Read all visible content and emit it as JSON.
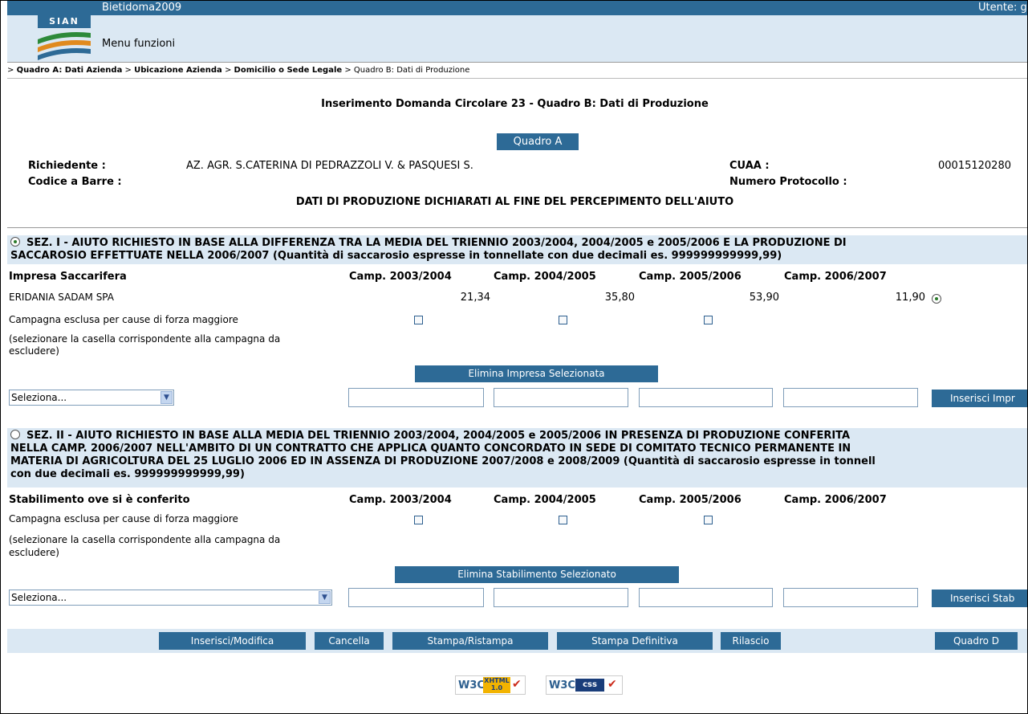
{
  "header": {
    "app_title": "Bietidoma2009",
    "user_label": "Utente: g",
    "menu": "Menu funzioni",
    "logo_text": "SIAN"
  },
  "breadcrumb": {
    "sep": ">",
    "items": [
      "Quadro A: Dati Azienda",
      "Ubicazione Azienda",
      "Domicilio o Sede Legale"
    ],
    "current": "Quadro B: Dati di Produzione"
  },
  "page_title": "Inserimento Domanda Circolare 23 - Quadro B: Dati di Produzione",
  "quadro_a_button": "Quadro A",
  "applicant": {
    "richiedente_label": "Richiedente :",
    "richiedente_value": "AZ. AGR. S.CATERINA DI PEDRAZZOLI V. & PASQUESI S.",
    "cuaa_label": "CUAA :",
    "cuaa_value": "00015120280",
    "barcode_label": "Codice a Barre :",
    "protocol_label": "Numero Protocollo :"
  },
  "subtitle": "DATI DI PRODUZIONE DICHIARATI AL FINE DEL PERCEPIMENTO DELL'AIUTO",
  "section1": {
    "selected": true,
    "title_line1": "SEZ. I - AIUTO RICHIESTO IN BASE ALLA DIFFERENZA TRA LA MEDIA DEL TRIENNIO 2003/2004, 2004/2005 e 2005/2006 E LA PRODUZIONE DI",
    "title_line2": "SACCAROSIO EFFETTUATE NELLA 2006/2007 (Quantità di saccarosio espresse in tonnellate con due decimali es. 999999999999,99)",
    "col_header": "Impresa Saccarifera",
    "campaigns": [
      "Camp. 2003/2004",
      "Camp. 2004/2005",
      "Camp. 2005/2006",
      "Camp. 2006/2007"
    ],
    "row": {
      "name": "ERIDANIA SADAM SPA",
      "values": [
        "21,34",
        "35,80",
        "53,90",
        "11,90"
      ]
    },
    "excluded_label": "Campagna esclusa per cause di forza maggiore",
    "hint_line1": "(selezionare la casella corrispondente alla campagna da",
    "hint_line2": "escludere)",
    "delete_button": "Elimina Impresa Selezionata",
    "select_value": "Seleziona...",
    "insert_button": "Inserisci Impr"
  },
  "section2": {
    "selected": false,
    "title_line1": "SEZ. II - AIUTO RICHIESTO IN BASE ALLA MEDIA DEL TRIENNIO 2003/2004, 2004/2005 e 2005/2006 IN PRESENZA DI PRODUZIONE CONFERITA",
    "title_line2": "NELLA CAMP. 2006/2007 NELL'AMBITO DI UN CONTRATTO CHE APPLICA QUANTO CONCORDATO IN SEDE DI COMITATO TECNICO PERMANENTE IN",
    "title_line3": "MATERIA DI AGRICOLTURA DEL 25 LUGLIO 2006 ED IN ASSENZA DI PRODUZIONE 2007/2008 e 2008/2009 (Quantità di saccarosio espresse in tonnell",
    "title_line4": "con due decimali es. 999999999999,99)",
    "col_header": "Stabilimento ove si è conferito",
    "campaigns": [
      "Camp. 2003/2004",
      "Camp. 2004/2005",
      "Camp. 2005/2006",
      "Camp. 2006/2007"
    ],
    "excluded_label": "Campagna esclusa per cause di forza maggiore",
    "hint_line1": "(selezionare la casella corrispondente alla campagna da",
    "hint_line2": "escludere)",
    "delete_button": "Elimina Stabilimento Selezionato",
    "select_value": "Seleziona...",
    "insert_button": "Inserisci Stab"
  },
  "footer_buttons": {
    "inserisci": "Inserisci/Modifica",
    "cancella": "Cancella",
    "stampa": "Stampa/Ristampa",
    "stampa_def": "Stampa Definitiva",
    "rilascio": "Rilascio",
    "quadro_d": "Quadro D"
  },
  "badges": {
    "xhtml_w3c": "W3C",
    "xhtml_text": "XHTML",
    "xhtml_ver": "1.0",
    "css_w3c": "W3C",
    "css_text": "css"
  }
}
